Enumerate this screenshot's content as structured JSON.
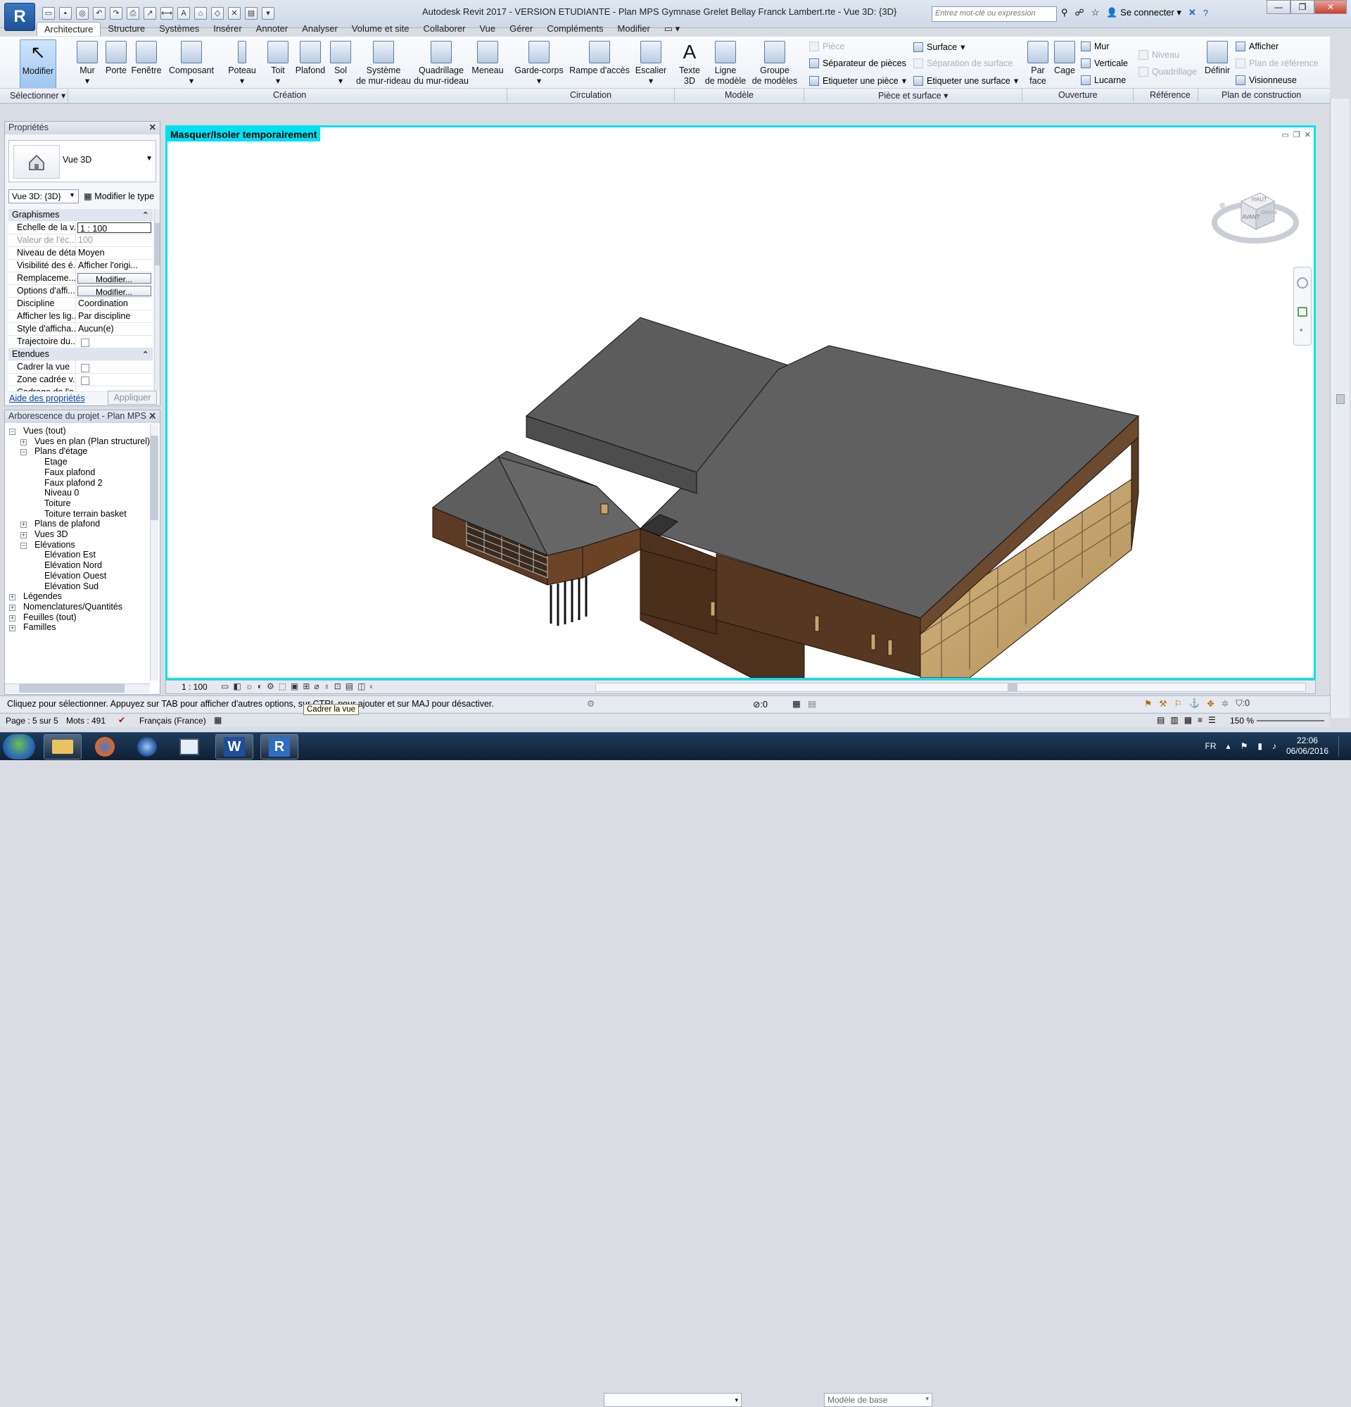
{
  "titlebar": {
    "logo": "R",
    "title": "Autodesk Revit 2017 - VERSION ETUDIANTE -      Plan MPS Gymnase Grelet Bellay Franck Lambert.rte - Vue 3D: {3D}",
    "search_placeholder": "Entrez mot-clé ou expression",
    "signin": "Se connecter",
    "help": "?"
  },
  "tabs": [
    "Architecture",
    "Structure",
    "Systèmes",
    "Insérer",
    "Annoter",
    "Analyser",
    "Volume et site",
    "Collaborer",
    "Vue",
    "Gérer",
    "Compléments",
    "Modifier"
  ],
  "active_tab": "Architecture",
  "ribbon": {
    "select": {
      "modify": "Modifier",
      "label": "Sélectionner"
    },
    "creation": {
      "label": "Création",
      "buttons": [
        {
          "name": "Mur"
        },
        {
          "name": "Porte"
        },
        {
          "name": "Fenêtre"
        },
        {
          "name": "Composant"
        },
        {
          "name": "Poteau"
        },
        {
          "name": "Toit"
        },
        {
          "name": "Plafond"
        },
        {
          "name": "Sol"
        },
        {
          "name": "Système",
          "name2": "de mur-rideau"
        },
        {
          "name": "Quadrillage",
          "name2": "du mur-rideau"
        },
        {
          "name": "Meneau"
        }
      ]
    },
    "circulation": {
      "label": "Circulation",
      "buttons": [
        {
          "name": "Garde-corps"
        },
        {
          "name": "Rampe d'accès"
        },
        {
          "name": "Escalier"
        }
      ]
    },
    "modele": {
      "label": "Modèle",
      "buttons": [
        {
          "name": "Texte",
          "name2": "3D"
        },
        {
          "name": "Ligne",
          "name2": "de modèle"
        },
        {
          "name": "Groupe",
          "name2": "de modèles"
        }
      ]
    },
    "piece": {
      "label": "Pièce et surface",
      "piece": "Pièce",
      "separateur": "Séparateur de pièces",
      "etiq_piece": "Etiqueter une pièce",
      "surface": "Surface",
      "sep_surface": "Séparation de surface",
      "etiq_surface": "Etiqueter une surface"
    },
    "ouverture": {
      "label": "Ouverture",
      "par_face": "Par",
      "par_face2": "face",
      "cage": "Cage",
      "mur": "Mur",
      "verticale": "Verticale",
      "lucarne": "Lucarne"
    },
    "reference": {
      "label": "Référence",
      "niveau": "Niveau",
      "quadrillage": "Quadrillage"
    },
    "plan": {
      "label": "Plan de construction",
      "definir": "Définir",
      "afficher": "Afficher",
      "plan_ref": "Plan de référence",
      "visionneuse": "Visionneuse"
    }
  },
  "properties": {
    "title": "Propriétés",
    "type_name": "Vue 3D",
    "view_select": "Vue 3D: {3D}",
    "edit_type": "Modifier le type",
    "group_graphics": "Graphismes",
    "rows": [
      {
        "k": "Echelle de la v...",
        "v": "1 : 100"
      },
      {
        "k": "Valeur de l'éc...",
        "v": "100"
      },
      {
        "k": "Niveau de détail",
        "v": "Moyen"
      },
      {
        "k": "Visibilité des é...",
        "v": "Afficher l'origi..."
      },
      {
        "k": "Remplaceme...",
        "v": "Modifier..."
      },
      {
        "k": "Options d'affi...",
        "v": "Modifier..."
      },
      {
        "k": "Discipline",
        "v": "Coordination"
      },
      {
        "k": "Afficher les lig...",
        "v": "Par discipline"
      },
      {
        "k": "Style d'afficha...",
        "v": "Aucun(e)"
      },
      {
        "k": "Trajectoire du...",
        "v": ""
      }
    ],
    "group_extents": "Etendues",
    "rows2": [
      {
        "k": "Cadrer la vue"
      },
      {
        "k": "Zone cadrée v..."
      },
      {
        "k": "Cadrage de l'a..."
      }
    ],
    "help_link": "Aide des propriétés",
    "apply": "Appliquer"
  },
  "browser": {
    "title": "Arborescence du projet - Plan MPS ...",
    "items": [
      {
        "t": "Vues (tout)",
        "lvl": 0
      },
      {
        "t": "Vues en plan (Plan structurel)",
        "lvl": 1
      },
      {
        "t": "Plans d'étage",
        "lvl": 1
      },
      {
        "t": "Etage",
        "lvl": 2
      },
      {
        "t": "Faux plafond",
        "lvl": 2
      },
      {
        "t": "Faux plafond 2",
        "lvl": 2
      },
      {
        "t": "Niveau 0",
        "lvl": 2
      },
      {
        "t": "Toiture",
        "lvl": 2
      },
      {
        "t": "Toiture terrain basket",
        "lvl": 2
      },
      {
        "t": "Plans de plafond",
        "lvl": 1
      },
      {
        "t": "Vues 3D",
        "lvl": 1
      },
      {
        "t": "Elévations",
        "lvl": 1
      },
      {
        "t": "Elévation Est",
        "lvl": 2
      },
      {
        "t": "Elévation Nord",
        "lvl": 2
      },
      {
        "t": "Elévation Ouest",
        "lvl": 2
      },
      {
        "t": "Elévation Sud",
        "lvl": 2
      },
      {
        "t": "Légendes",
        "lvl": 0
      },
      {
        "t": "Nomenclatures/Quantités",
        "lvl": 0
      },
      {
        "t": "Feuilles (tout)",
        "lvl": 0
      },
      {
        "t": "Familles",
        "lvl": 0
      }
    ]
  },
  "viewport": {
    "isolate_label": "Masquer/Isoler temporairement",
    "viewcube_top": "HAUT",
    "viewcube_front": "AVANT",
    "viewcube_right": "DROITE",
    "colors": {
      "roof": "#5f5f5f",
      "wall": "#5a3a22",
      "glass": "#c9a46a",
      "accent": "#00e0f0"
    }
  },
  "view_bar": {
    "scale": "1 : 100"
  },
  "status": {
    "message": "Cliquez pour sélectionner. Appuyez sur TAB pour afficher d'autres options, sur CTRL pour ajouter et sur MAJ pour désactiver.",
    "tooltip": "Cadrer la vue",
    "count0": ":0",
    "model": "Modèle de base",
    "filter": ":0"
  },
  "status2": {
    "page": "Page : 5 sur 5",
    "words": "Mots : 491",
    "lang": "Français (France)",
    "zoom": "150 %"
  },
  "taskbar": {
    "lang": "FR",
    "time": "22:06",
    "date": "06/06/2016",
    "revit": "R",
    "word": "W"
  }
}
